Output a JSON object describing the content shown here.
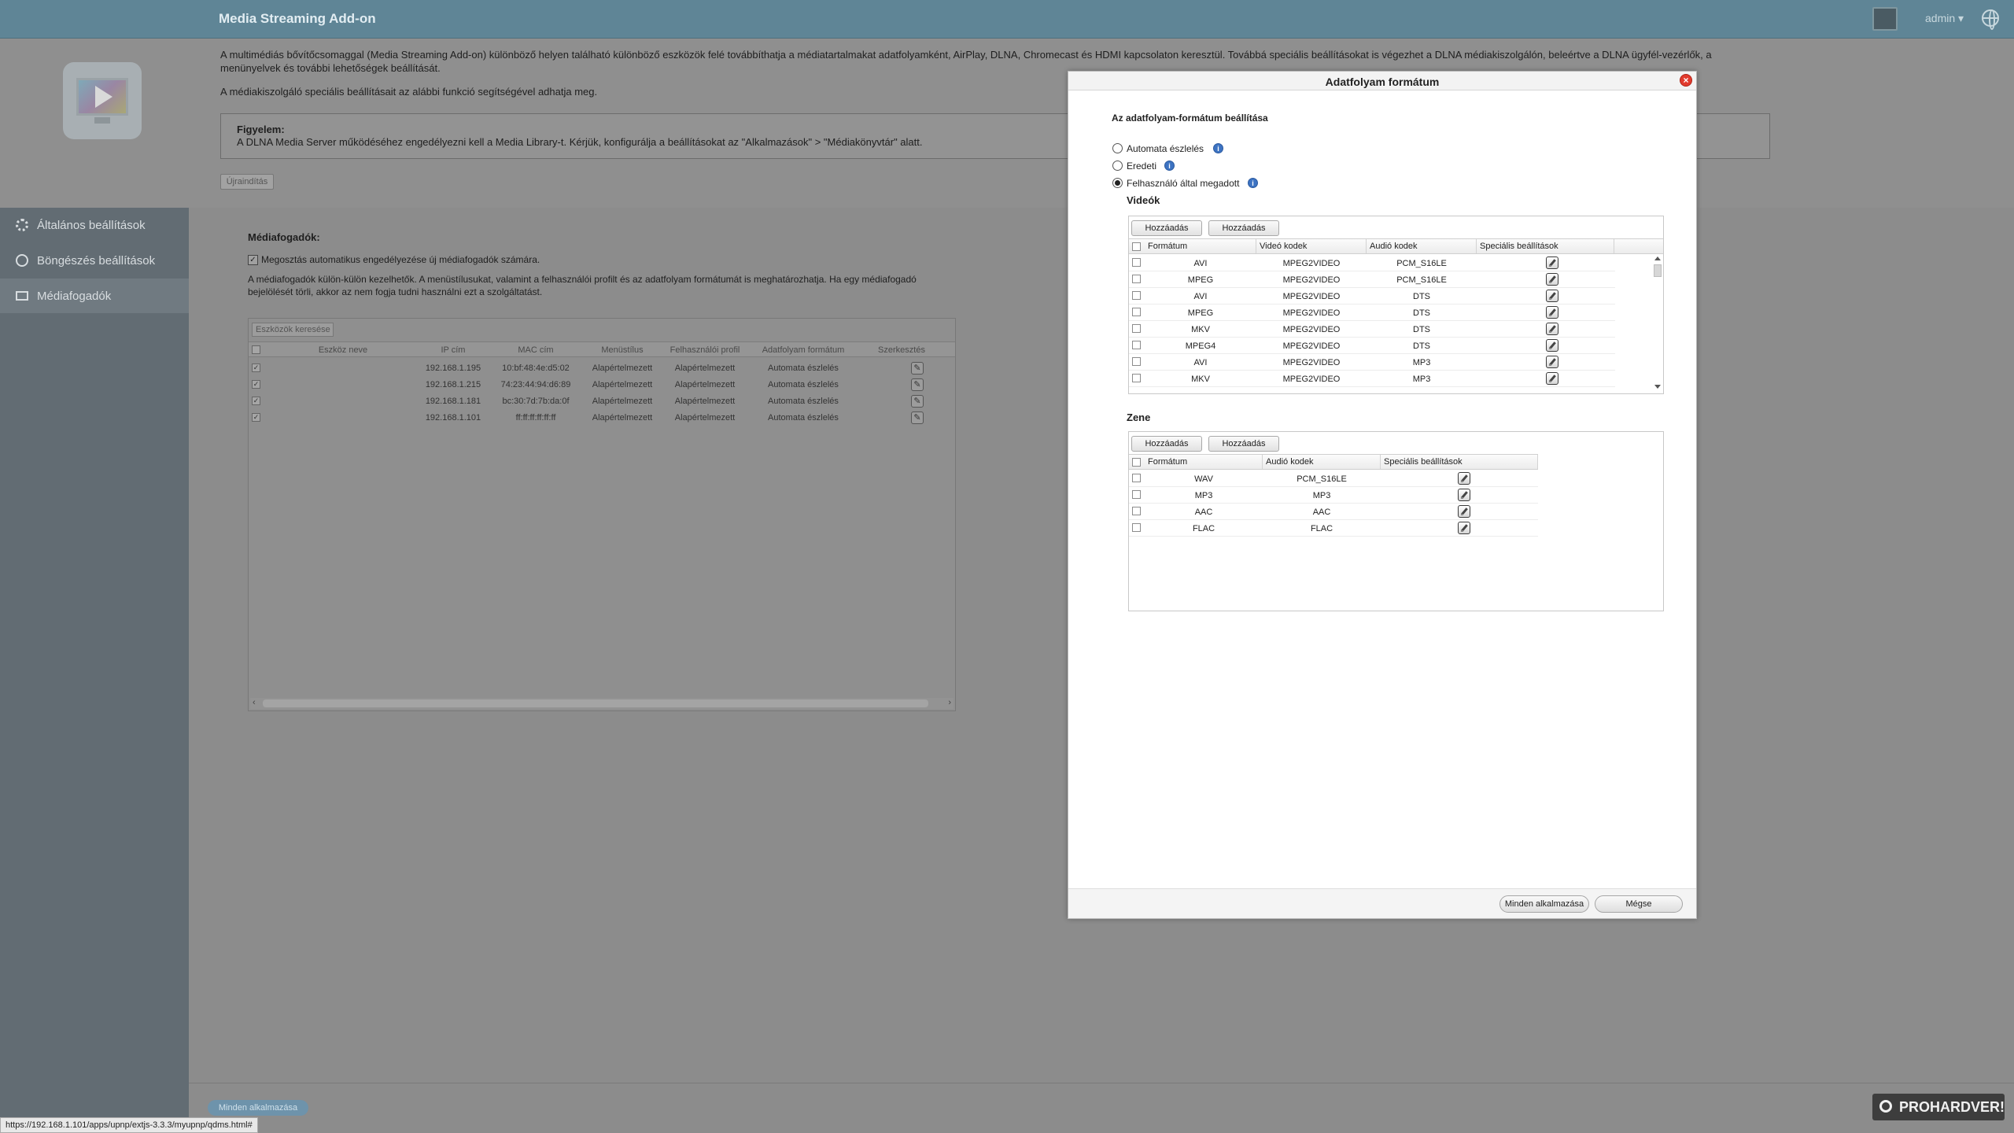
{
  "app": {
    "title": "Media Streaming Add-on",
    "user_menu": "admin ▾"
  },
  "intro": {
    "paragraph1": "A multimédiás bővítőcsomaggal (Media Streaming Add-on) különböző helyen található különböző eszközök felé továbbíthatja a médiatartalmakat adatfolyamként, AirPlay, DLNA, Chromecast és HDMI kapcsolaton keresztül. Továbbá speciális beállításokat is végezhet a DLNA médiakiszolgálón, beleértve a DLNA ügyfél-vezérlők, a menünyelvek és további lehetőségek beállítását.",
    "paragraph2": "A médiakiszolgáló speciális beállításait az alábbi funkció segítségével adhatja meg.",
    "notice_title": "Figyelem:",
    "notice_body": "A DLNA Media Server működéséhez engedélyezni kell a Media Library-t. Kérjük, konfigurálja a beállításokat az \"Alkalmazások\" > \"Médiakönyvtár\" alatt.",
    "restart_label": "Újraindítás"
  },
  "sidebar": {
    "items": [
      {
        "label": "Általános beállítások",
        "icon": "gear-icon"
      },
      {
        "label": "Böngészés beállítások",
        "icon": "compass-icon"
      },
      {
        "label": "Médiafogadók",
        "icon": "monitor-icon"
      }
    ]
  },
  "receivers": {
    "title": "Médiafogadók:",
    "auto_share_label": "Megosztás automatikus engedélyezése új médiafogadók számára.",
    "description": "A médiafogadók külön-külön kezelhetők. A menüstílusukat, valamint a felhasználói profilt és az adatfolyam formátumát is meghatározhatja. Ha egy médiafogadó bejelölését törli, akkor az nem fogja tudni használni ezt a szolgáltatást.",
    "search_label": "Eszközök keresése",
    "columns": [
      "Eszköz neve",
      "IP cím",
      "MAC cím",
      "Menüstílus",
      "Felhasználói profil",
      "Adatfolyam formátum",
      "Szerkesztés"
    ],
    "rows": [
      {
        "name": "",
        "ip": "192.168.1.195",
        "mac": "10:bf:48:4e:d5:02",
        "menu": "Alapértelmezett",
        "profile": "Alapértelmezett",
        "format": "Automata észlelés"
      },
      {
        "name": "",
        "ip": "192.168.1.215",
        "mac": "74:23:44:94:d6:89",
        "menu": "Alapértelmezett",
        "profile": "Alapértelmezett",
        "format": "Automata észlelés"
      },
      {
        "name": "",
        "ip": "192.168.1.181",
        "mac": "bc:30:7d:7b:da:0f",
        "menu": "Alapértelmezett",
        "profile": "Alapértelmezett",
        "format": "Automata észlelés"
      },
      {
        "name": "",
        "ip": "192.168.1.101",
        "mac": "ff:ff:ff:ff:ff:ff",
        "menu": "Alapértelmezett",
        "profile": "Alapértelmezett",
        "format": "Automata észlelés"
      }
    ]
  },
  "footer": {
    "apply_all_label": "Minden alkalmazása",
    "status_url": "https://192.168.1.101/apps/upnp/extjs-3.3.3/myupnp/qdms.html#",
    "watermark": "PROHARDVER!"
  },
  "modal": {
    "title": "Adatfolyam formátum",
    "section_heading": "Az adatfolyam-formátum beállítása",
    "radio_options": [
      {
        "label": "Automata észlelés",
        "selected": false
      },
      {
        "label": "Eredeti",
        "selected": false
      },
      {
        "label": "Felhasználó által megadott",
        "selected": true
      }
    ],
    "videos": {
      "label": "Videók",
      "add_label_1": "Hozzáadás",
      "add_label_2": "Hozzáadás",
      "columns": [
        "Formátum",
        "Videó kodek",
        "Audió kodek",
        "Speciális beállítások"
      ],
      "rows": [
        {
          "format": "AVI",
          "video": "MPEG2VIDEO",
          "audio": "PCM_S16LE"
        },
        {
          "format": "MPEG",
          "video": "MPEG2VIDEO",
          "audio": "PCM_S16LE"
        },
        {
          "format": "AVI",
          "video": "MPEG2VIDEO",
          "audio": "DTS"
        },
        {
          "format": "MPEG",
          "video": "MPEG2VIDEO",
          "audio": "DTS"
        },
        {
          "format": "MKV",
          "video": "MPEG2VIDEO",
          "audio": "DTS"
        },
        {
          "format": "MPEG4",
          "video": "MPEG2VIDEO",
          "audio": "DTS"
        },
        {
          "format": "AVI",
          "video": "MPEG2VIDEO",
          "audio": "MP3"
        },
        {
          "format": "MKV",
          "video": "MPEG2VIDEO",
          "audio": "MP3"
        }
      ]
    },
    "music": {
      "label": "Zene",
      "add_label_1": "Hozzáadás",
      "add_label_2": "Hozzáadás",
      "columns": [
        "Formátum",
        "Audió kodek",
        "Speciális beállítások"
      ],
      "rows": [
        {
          "format": "WAV",
          "audio": "PCM_S16LE"
        },
        {
          "format": "MP3",
          "audio": "MP3"
        },
        {
          "format": "AAC",
          "audio": "AAC"
        },
        {
          "format": "FLAC",
          "audio": "FLAC"
        }
      ]
    },
    "apply_all_label": "Minden alkalmazása",
    "cancel_label": "Mégse"
  }
}
